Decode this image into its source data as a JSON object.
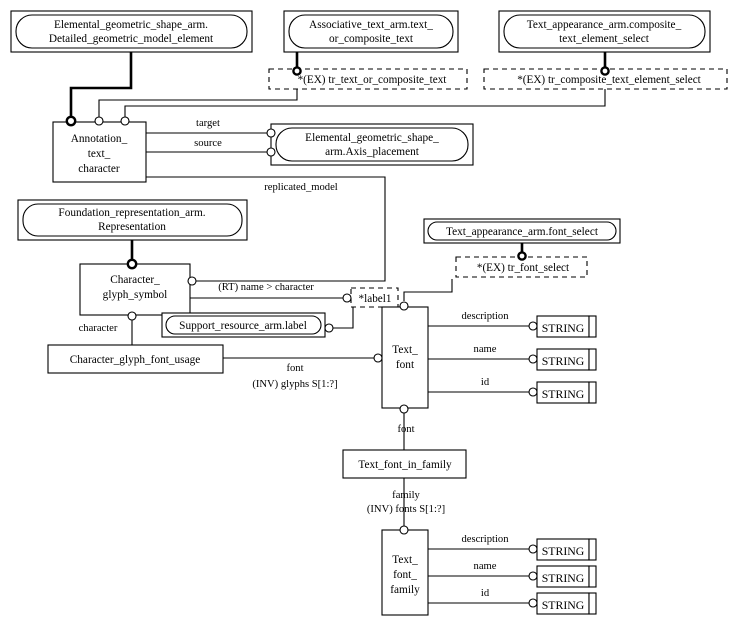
{
  "diagram": {
    "title": "EXPRESS-G entity-level diagram for text font schema",
    "type": "express-g"
  },
  "external_refs": [
    {
      "id": "ref-detailed-geometric-model-element",
      "line1": "Elemental_geometric_shape_arm.",
      "line2": "Detailed_geometric_model_element"
    },
    {
      "id": "ref-text-or-composite-text",
      "line1": "Associative_text_arm.text_",
      "line2": "or_composite_text"
    },
    {
      "id": "ref-composite-text-element-select",
      "line1": "Text_appearance_arm.composite_",
      "line2": "text_element_select"
    },
    {
      "id": "ref-axis-placement",
      "line1": "Elemental_geometric_shape_",
      "line2": "arm.Axis_placement"
    },
    {
      "id": "ref-representation",
      "line1": "Foundation_representation_arm.",
      "line2": "Representation"
    },
    {
      "id": "ref-label",
      "line1": "Support_resource_arm.label",
      "line2": ""
    },
    {
      "id": "ref-font-select",
      "line1": "Text_appearance_arm.font_select",
      "line2": ""
    }
  ],
  "page_refs": [
    {
      "id": "pageref-text-or-composite-text",
      "label": "*(EX) tr_text_or_composite_text"
    },
    {
      "id": "pageref-composite-text-element-select",
      "label": "*(EX) tr_composite_text_element_select"
    },
    {
      "id": "pageref-font-select",
      "label": "*(EX) tr_font_select"
    },
    {
      "id": "pageref-label1",
      "label": "*label1"
    }
  ],
  "entities": [
    {
      "id": "entity-annotation-text-character",
      "lines": [
        "Annotation_",
        "text_",
        "character"
      ]
    },
    {
      "id": "entity-character-glyph-symbol",
      "lines": [
        "Character_",
        "glyph_symbol"
      ]
    },
    {
      "id": "entity-character-glyph-font-usage",
      "lines": [
        "Character_glyph_font_usage"
      ]
    },
    {
      "id": "entity-text-font",
      "lines": [
        "Text_",
        "font"
      ]
    },
    {
      "id": "entity-text-font-in-family",
      "lines": [
        "Text_font_in_family"
      ]
    },
    {
      "id": "entity-text-font-family",
      "lines": [
        "Text_",
        "font_",
        "family"
      ]
    }
  ],
  "primitives": [
    {
      "id": "string-textfont-description",
      "label": "STRING"
    },
    {
      "id": "string-textfont-name",
      "label": "STRING"
    },
    {
      "id": "string-textfont-id",
      "label": "STRING"
    },
    {
      "id": "string-textfontfamily-description",
      "label": "STRING"
    },
    {
      "id": "string-textfontfamily-name",
      "label": "STRING"
    },
    {
      "id": "string-textfontfamily-id",
      "label": "STRING"
    }
  ],
  "relationship_labels": [
    {
      "id": "rel-target",
      "text": "target"
    },
    {
      "id": "rel-source",
      "text": "source"
    },
    {
      "id": "rel-replicated-model",
      "text": "replicated_model"
    },
    {
      "id": "rel-rt-name-character",
      "text": "(RT) name > character"
    },
    {
      "id": "rel-character",
      "text": "character"
    },
    {
      "id": "rel-font-usage",
      "text": "font"
    },
    {
      "id": "rel-inv-glyphs",
      "text": "(INV) glyphs S[1:?]"
    },
    {
      "id": "rel-font-family",
      "text": "font"
    },
    {
      "id": "rel-family",
      "text": "family"
    },
    {
      "id": "rel-inv-fonts",
      "text": "(INV) fonts S[1:?]"
    },
    {
      "id": "rel-textfont-description",
      "text": "description"
    },
    {
      "id": "rel-textfont-name",
      "text": "name"
    },
    {
      "id": "rel-textfont-id",
      "text": "id"
    },
    {
      "id": "rel-textfontfamily-description",
      "text": "description"
    },
    {
      "id": "rel-textfontfamily-name",
      "text": "name"
    },
    {
      "id": "rel-textfontfamily-id",
      "text": "id"
    }
  ],
  "colors": {
    "background": "#ffffff",
    "stroke": "#000000",
    "fill": "#ffffff"
  }
}
